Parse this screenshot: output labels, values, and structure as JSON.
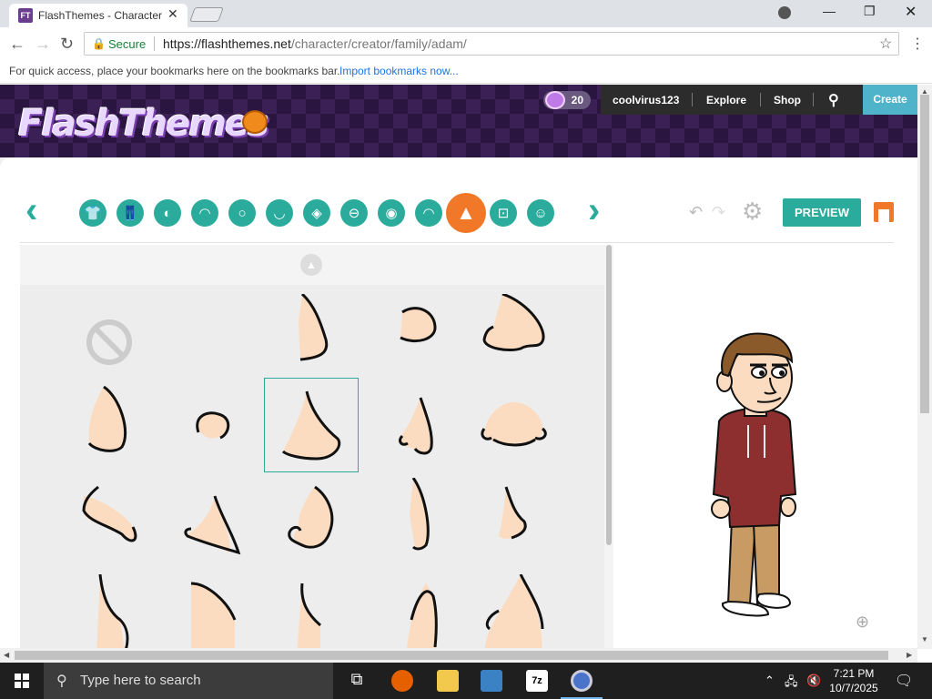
{
  "browser": {
    "tab_title": "FlashThemes - Character",
    "favicon_text": "FT",
    "secure_label": "Secure",
    "url_host": "https://flashthemes.net",
    "url_path": "/character/creator/family/adam/",
    "bookmarks_hint": "For quick access, place your bookmarks here on the bookmarks bar.",
    "import_bookmarks": "Import bookmarks now..."
  },
  "site": {
    "logo": "FlashThemes",
    "coins": "20",
    "nav": {
      "username": "coolvirus123",
      "explore": "Explore",
      "shop": "Shop",
      "create": "Create"
    }
  },
  "creator": {
    "preview_label": "PREVIEW",
    "categories": [
      {
        "name": "upper-body",
        "icon": "shirt-icon",
        "glyph": "👕"
      },
      {
        "name": "lower-body",
        "icon": "pants-icon",
        "glyph": "👖"
      },
      {
        "name": "face-shape",
        "icon": "face-shape-icon",
        "glyph": "◐"
      },
      {
        "name": "hair",
        "icon": "hair-icon",
        "glyph": "◠"
      },
      {
        "name": "head",
        "icon": "head-icon",
        "glyph": "○"
      },
      {
        "name": "mouth",
        "icon": "mouth-icon",
        "glyph": "◡"
      },
      {
        "name": "accessory",
        "icon": "tag-icon",
        "glyph": "◈"
      },
      {
        "name": "eyelids",
        "icon": "eyelids-icon",
        "glyph": "⊖"
      },
      {
        "name": "eyes",
        "icon": "eyes-icon",
        "glyph": "◉"
      },
      {
        "name": "eyebrows",
        "icon": "eyebrows-icon",
        "glyph": "◜◝"
      },
      {
        "name": "nose",
        "icon": "nose-icon",
        "glyph": "▲"
      },
      {
        "name": "glasses",
        "icon": "glasses-icon",
        "glyph": "⊡"
      },
      {
        "name": "beard",
        "icon": "beard-icon",
        "glyph": "☺"
      }
    ]
  },
  "taskbar": {
    "search_placeholder": "Type here to search",
    "time": "7:21 PM",
    "date": "10/7/2025"
  },
  "colors": {
    "accent": "#2aab9c",
    "active": "#f07828",
    "skin": "#fcdcc0",
    "hoodie": "#8e2f2f",
    "pants": "#c89a64"
  }
}
